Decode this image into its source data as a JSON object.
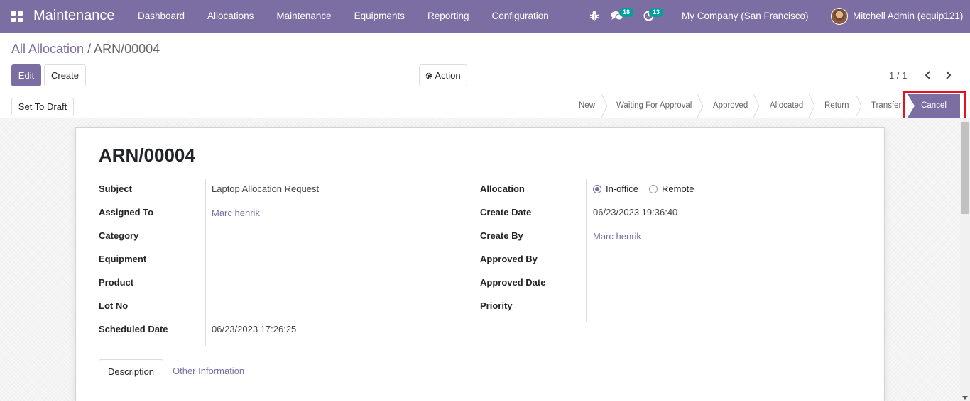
{
  "navbar": {
    "brand": "Maintenance",
    "menu": [
      "Dashboard",
      "Allocations",
      "Maintenance",
      "Equipments",
      "Reporting",
      "Configuration"
    ],
    "messages_count": "18",
    "activities_count": "13",
    "company": "My Company (San Francisco)",
    "user": "Mitchell Admin (equip121)",
    "accent_color": "#7c6ea3"
  },
  "breadcrumb": {
    "parent": "All Allocation",
    "separator": "/",
    "current": "ARN/00004"
  },
  "buttons": {
    "edit": "Edit",
    "create": "Create",
    "action": "Action",
    "set_to_draft": "Set To Draft"
  },
  "pager": {
    "value": "1 / 1"
  },
  "statusbar": {
    "stages": [
      "New",
      "Waiting For Approval",
      "Approved",
      "Allocated",
      "Return",
      "Transfer"
    ],
    "active": "Cancel"
  },
  "record": {
    "title": "ARN/00004",
    "left": [
      {
        "label": "Subject",
        "value": "Laptop Allocation Request"
      },
      {
        "label": "Assigned To",
        "value": "Marc henrik"
      },
      {
        "label": "Category",
        "value": ""
      },
      {
        "label": "Equipment",
        "value": ""
      },
      {
        "label": "Product",
        "value": ""
      },
      {
        "label": "Lot No",
        "value": ""
      },
      {
        "label": "Scheduled Date",
        "value": "06/23/2023 17:26:25"
      }
    ],
    "right": [
      {
        "label": "Allocation",
        "value": ""
      },
      {
        "label": "Create Date",
        "value": "06/23/2023 19:36:40"
      },
      {
        "label": "Create By",
        "value": "Marc henrik"
      },
      {
        "label": "Approved By",
        "value": ""
      },
      {
        "label": "Approved Date",
        "value": ""
      },
      {
        "label": "Priority",
        "value": ""
      }
    ],
    "allocation_options": {
      "selected": "In-office",
      "other": "Remote"
    }
  },
  "tabs": [
    "Description",
    "Other Information"
  ]
}
